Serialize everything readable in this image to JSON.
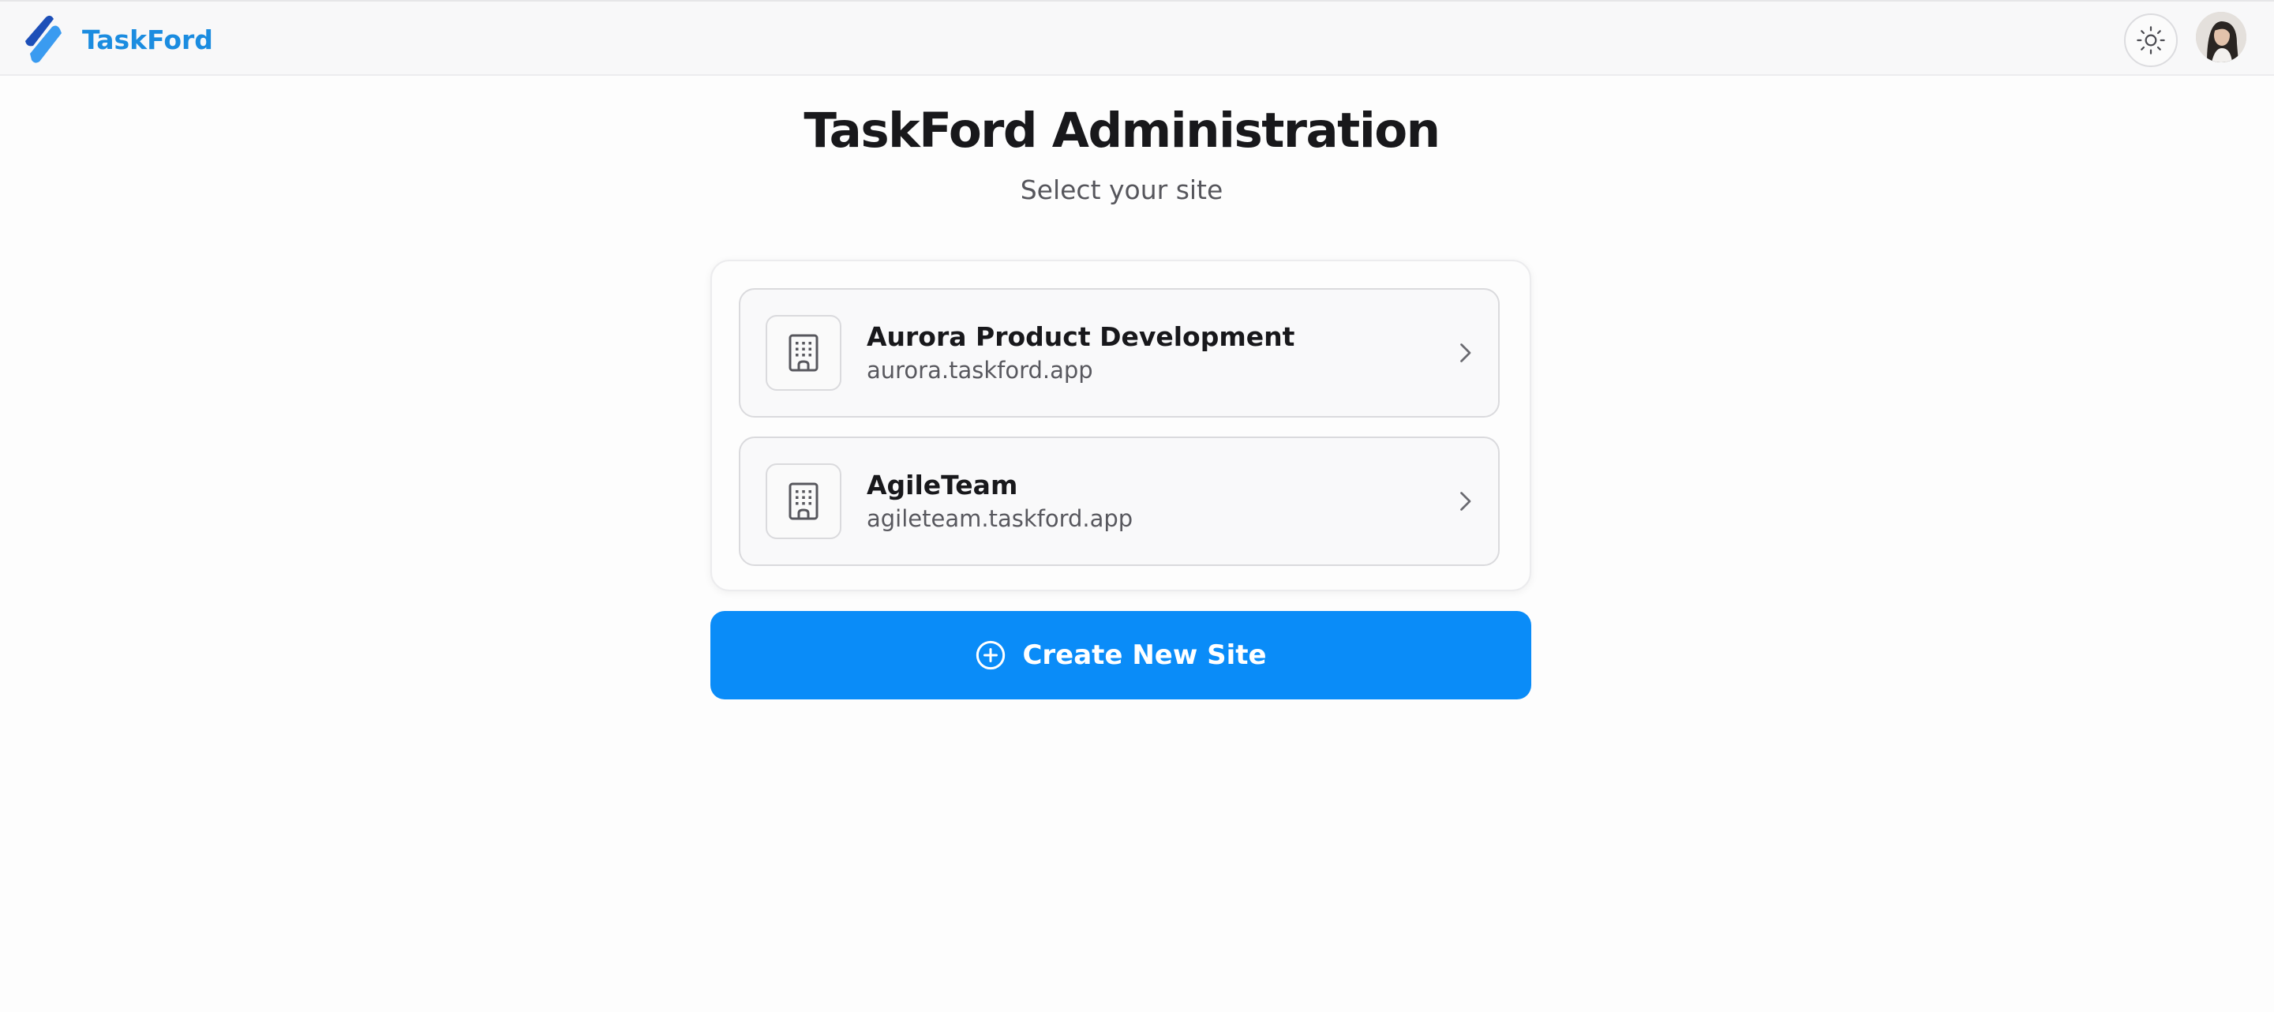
{
  "app": {
    "brand_name": "TaskFord",
    "brand_color": "#1b8ce0",
    "logo_icon": "taskford-logo-icon"
  },
  "header": {
    "theme_toggle_icon": "sun-icon",
    "avatar": "user-avatar"
  },
  "main": {
    "title": "TaskFord Administration",
    "subtitle": "Select your site",
    "sites": [
      {
        "name": "Aurora Product Development",
        "domain": "aurora.taskford.app",
        "icon": "building-icon"
      },
      {
        "name": "AgileTeam",
        "domain": "agileteam.taskford.app",
        "icon": "building-icon"
      }
    ],
    "create_button": {
      "label": "Create New Site",
      "icon": "plus-circle-icon",
      "color": "#0a8cf8"
    }
  }
}
